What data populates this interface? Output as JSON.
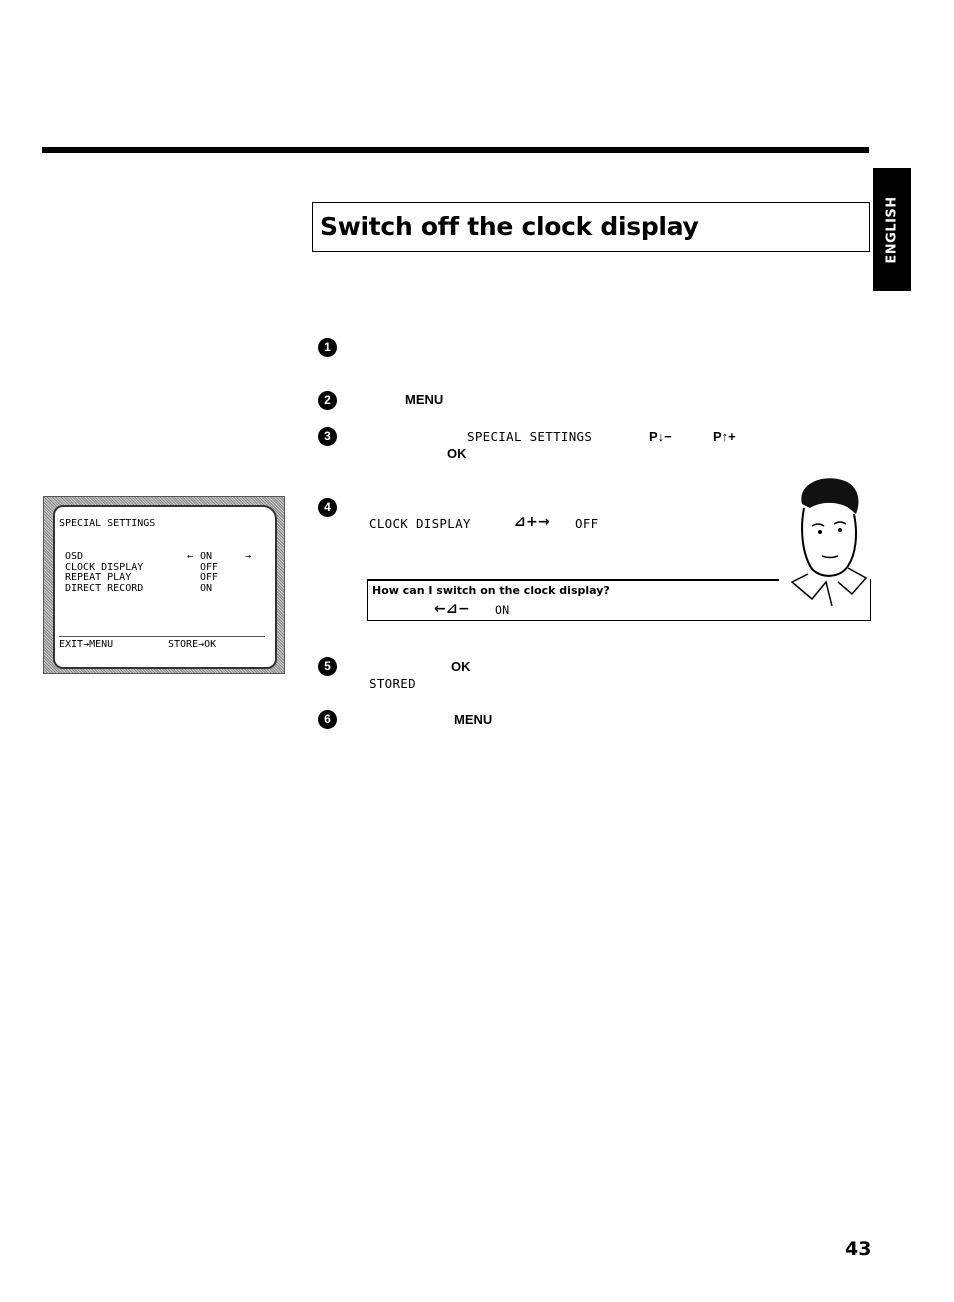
{
  "header": {
    "language_tab": "ENGLISH"
  },
  "section": {
    "title": "Switch off the clock display"
  },
  "steps": [
    {
      "number": "1"
    },
    {
      "number": "2",
      "key": "MENU"
    },
    {
      "number": "3",
      "osd_text": "SPECIAL SETTINGS",
      "key_down": "P↓−",
      "key_up": "P↑+",
      "confirm_key": "OK"
    },
    {
      "number": "4",
      "osd_item": "CLOCK DISPLAY",
      "action_symbol": "⊿+→",
      "osd_value": "OFF"
    },
    {
      "number": "5",
      "key": "OK",
      "osd_text": "STORED"
    },
    {
      "number": "6",
      "key": "MENU"
    }
  ],
  "tip": {
    "question": "How can I switch on the clock display?",
    "action_symbol": "←⊿−",
    "value": "ON"
  },
  "tv_screen": {
    "title": "SPECIAL SETTINGS",
    "rows": [
      {
        "label": "OSD",
        "value": "ON",
        "left_arrow": "←",
        "right_arrow": "→"
      },
      {
        "label": "CLOCK DISPLAY",
        "value": "OFF"
      },
      {
        "label": "REPEAT PLAY",
        "value": "OFF"
      },
      {
        "label": "DIRECT RECORD",
        "value": "ON"
      }
    ],
    "footer_left": "EXIT→MENU",
    "footer_right": "STORE→OK"
  },
  "footer": {
    "page_number": "43"
  }
}
